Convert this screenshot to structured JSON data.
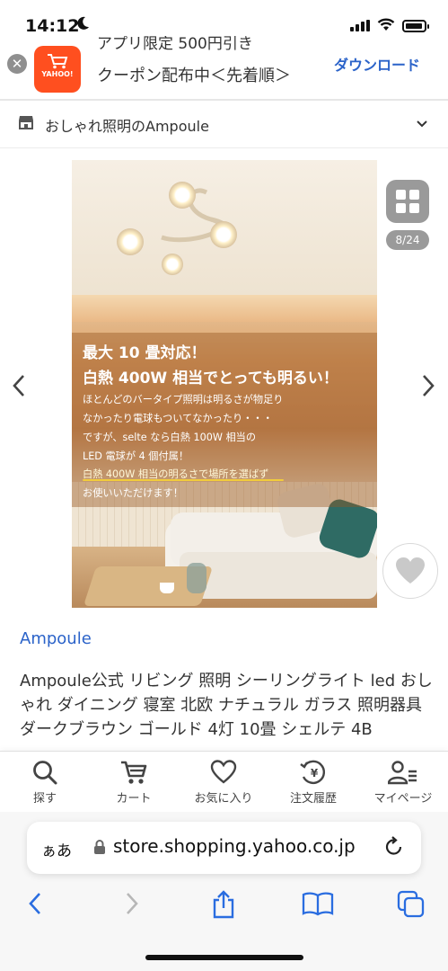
{
  "status_bar": {
    "time": "14:12",
    "battery_level": 0.8
  },
  "banner": {
    "app_label": "YAHOO!",
    "line1": "アプリ限定 500円引き",
    "line2": "クーポン配布中＜先着順＞",
    "download": "ダウンロード"
  },
  "store": {
    "name": "おしゃれ照明のAmpoule"
  },
  "gallery": {
    "counter": "8/24",
    "overlay": {
      "heading1": "最大 10 畳対応！",
      "heading2": "白熱 400W 相当でとっても明るい！",
      "lines": [
        "ほとんどのバータイプ照明は明るさが物足り",
        "なかったり電球もついてなかったり・・・",
        "ですが、selte なら白熱 100W 相当の",
        "LED 電球が 4 個付属！",
        "白熱 400W 相当の明るさで場所を選ばず",
        "お使いいただけます！"
      ]
    }
  },
  "product": {
    "brand": "Ampoule",
    "title": "Ampoule公式 リビング 照明 シーリングライト led おしゃれ ダイニング 寝室 北欧 ナチュラル ガラス 照明器具 ダークブラウン ゴールド 4灯 10畳 シェルテ 4B"
  },
  "tabs": [
    {
      "label": "探す",
      "icon": "search-icon"
    },
    {
      "label": "カート",
      "icon": "cart-icon"
    },
    {
      "label": "お気に入り",
      "icon": "heart-icon"
    },
    {
      "label": "注文履歴",
      "icon": "order-history-icon"
    },
    {
      "label": "マイページ",
      "icon": "account-icon"
    }
  ],
  "safari": {
    "aa": "ぁあ",
    "url": "store.shopping.yahoo.co.jp"
  },
  "colors": {
    "link": "#2b63c9",
    "banner_app": "#ff4f1f",
    "highlight_underline": "#f2cc3b"
  }
}
